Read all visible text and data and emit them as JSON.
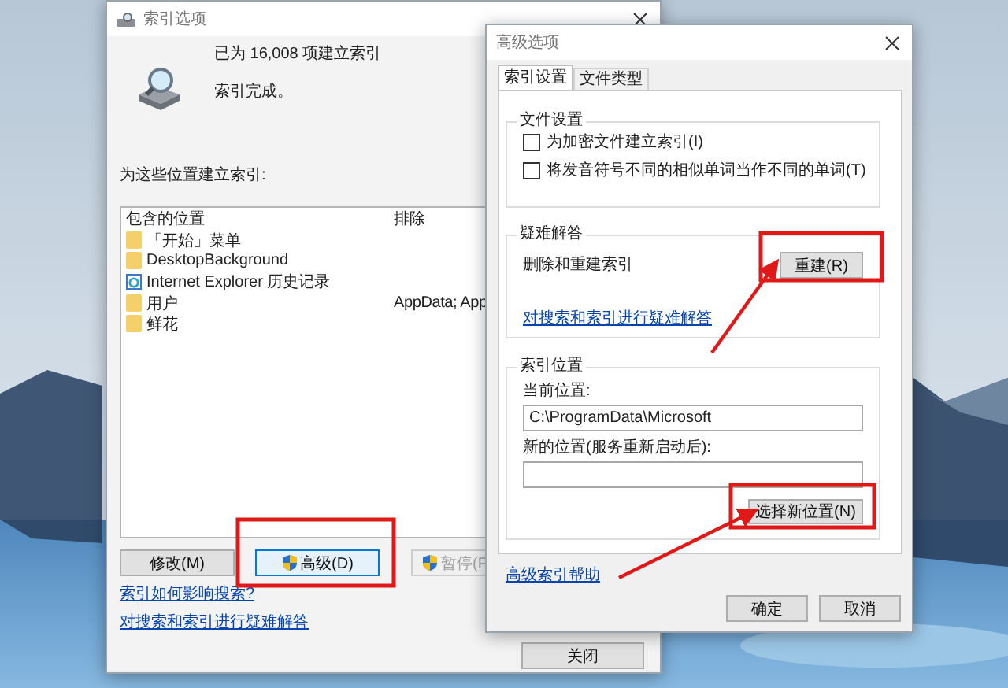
{
  "main_window": {
    "title": "索引选项",
    "indexed_count": "已为 16,008 项建立索引",
    "status": "索引完成。",
    "locations_label": "为这些位置建立索引:",
    "table": {
      "columns": [
        "包含的位置",
        "排除"
      ],
      "rows": [
        {
          "kind": "folder",
          "location": "「开始」菜单"
        },
        {
          "kind": "folder",
          "location": "DesktopBackground"
        },
        {
          "kind": "browser",
          "location": "Internet Explorer 历史记录"
        },
        {
          "kind": "folder",
          "location": "用户",
          "exclude": "AppData; App"
        },
        {
          "kind": "folder",
          "location": "鲜花"
        }
      ]
    },
    "buttons": [
      {
        "label": "修改(M)",
        "shield": false,
        "disabled": false
      },
      {
        "label": "高级(D)",
        "shield": true,
        "disabled": false
      },
      {
        "label": "暂停(P",
        "shield": true,
        "disabled": true
      }
    ],
    "links": [
      "索引如何影响搜索?",
      "对搜索和索引进行疑难解答"
    ],
    "close_button": "关闭"
  },
  "advanced_window": {
    "title": "高级选项",
    "tabs": [
      {
        "label": "索引设置",
        "selected": true
      },
      {
        "label": "文件类型",
        "selected": false
      }
    ],
    "file_settings": {
      "title": "文件设置",
      "checkboxes": [
        {
          "label": "为加密文件建立索引(I)",
          "checked": false
        },
        {
          "label": "将发音符号不同的相似单词当作不同的单词(T)",
          "checked": false
        }
      ]
    },
    "troubleshooting": {
      "title": "疑难解答",
      "label": "删除和重建索引",
      "button": "重建(R)",
      "link": "对搜索和索引进行疑难解答"
    },
    "index_location": {
      "title": "索引位置",
      "current_label": "当前位置:",
      "current_value": "C:\\ProgramData\\Microsoft",
      "new_label": "新的位置(服务重新启动后):",
      "button": "选择新位置(N)"
    },
    "help_link": "高级索引帮助",
    "buttons": [
      "确定",
      "取消"
    ]
  }
}
